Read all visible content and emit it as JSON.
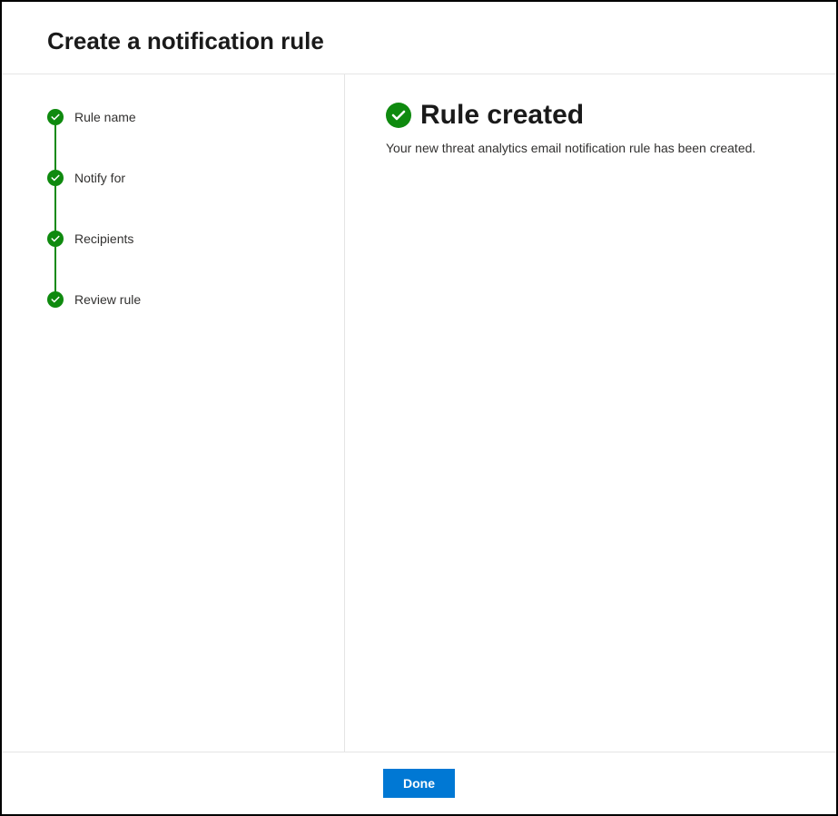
{
  "header": {
    "title": "Create a notification rule"
  },
  "stepper": {
    "steps": [
      {
        "label": "Rule name"
      },
      {
        "label": "Notify for"
      },
      {
        "label": "Recipients"
      },
      {
        "label": "Review rule"
      }
    ]
  },
  "main": {
    "heading": "Rule created",
    "description": "Your new threat analytics email notification rule has been created."
  },
  "footer": {
    "done_label": "Done"
  },
  "colors": {
    "success": "#0f8a0f",
    "primary": "#0078d4"
  }
}
